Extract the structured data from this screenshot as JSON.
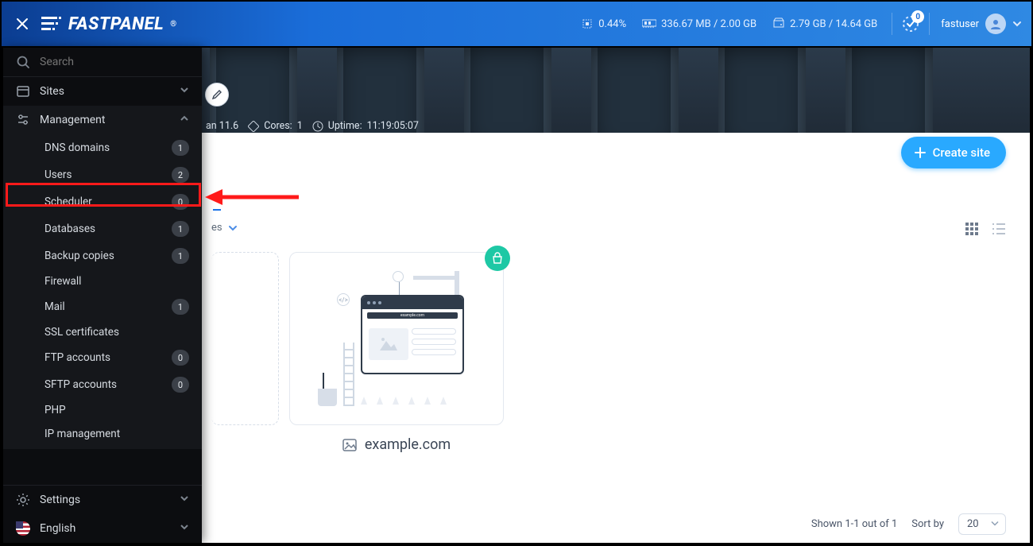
{
  "brand": {
    "name": "FASTPANEL",
    "mark": "®"
  },
  "header": {
    "cpu_pct": "0.44%",
    "ram": "336.67 MB / 2.00 GB",
    "disk": "2.79 GB / 14.64 GB",
    "notifications": "0",
    "username": "fastuser"
  },
  "hero": {
    "os_fragment": "an 11.6",
    "cores_label": "Cores:",
    "cores_value": "1",
    "uptime_label": "Uptime:",
    "uptime_value": "11:19:05:07"
  },
  "search": {
    "placeholder": "Search"
  },
  "sidebar": {
    "sites_label": "Sites",
    "management_label": "Management",
    "settings_label": "Settings",
    "language_label": "English",
    "items": [
      {
        "label": "DNS domains",
        "count": "1"
      },
      {
        "label": "Users",
        "count": "2"
      },
      {
        "label": "Scheduler",
        "count": "0"
      },
      {
        "label": "Databases",
        "count": "1"
      },
      {
        "label": "Backup copies",
        "count": "1"
      },
      {
        "label": "Firewall",
        "count": ""
      },
      {
        "label": "Mail",
        "count": "1"
      },
      {
        "label": "SSL certificates",
        "count": ""
      },
      {
        "label": "FTP accounts",
        "count": "0"
      },
      {
        "label": "SFTP accounts",
        "count": "0"
      },
      {
        "label": "PHP",
        "count": ""
      },
      {
        "label": "IP management",
        "count": ""
      }
    ]
  },
  "main": {
    "create_label": "Create site",
    "filter_suffix": "es",
    "site_name": "example.com",
    "illus_url": "example.com",
    "shown_text": "Shown 1-1 out of 1",
    "sort_by_label": "Sort by",
    "page_size": "20"
  }
}
